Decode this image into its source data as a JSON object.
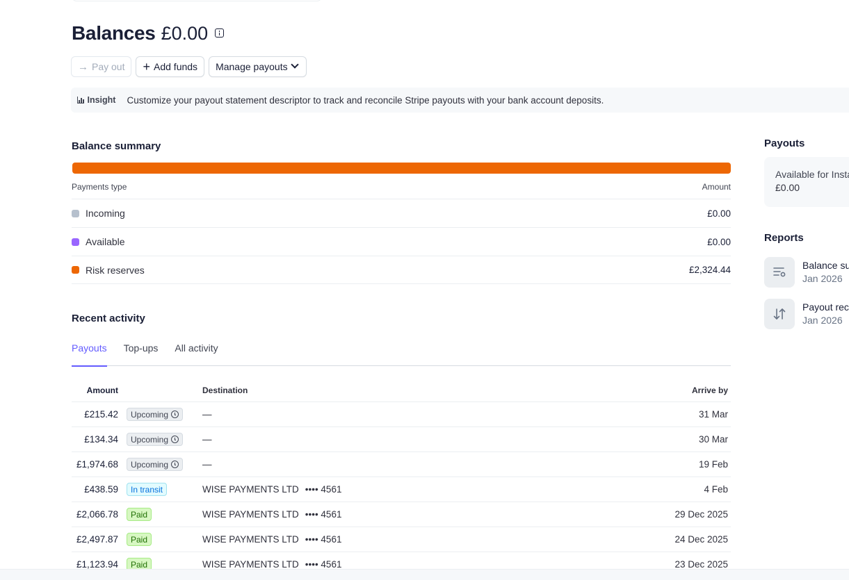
{
  "header": {
    "title": "Balances",
    "amount": "£0.00"
  },
  "actions": {
    "pay_out": "Pay out",
    "add_funds": "Add funds",
    "manage_payouts": "Manage payouts"
  },
  "insight": {
    "badge": "Insight",
    "text": "Customize your payout statement descriptor to track and reconcile Stripe payouts with your bank account deposits."
  },
  "balance_summary": {
    "title": "Balance summary",
    "bar_color": "#ed6704",
    "col_type": "Payments type",
    "col_amount": "Amount",
    "rows": [
      {
        "label": "Incoming",
        "amount": "£0.00",
        "color": "#b6c0cd"
      },
      {
        "label": "Available",
        "amount": "£0.00",
        "color": "#9966ff"
      },
      {
        "label": "Risk reserves",
        "amount": "£2,324.44",
        "color": "#ed6704"
      }
    ]
  },
  "recent_activity": {
    "title": "Recent activity",
    "tabs": [
      {
        "label": "Payouts",
        "active": true
      },
      {
        "label": "Top-ups",
        "active": false
      },
      {
        "label": "All activity",
        "active": false
      }
    ],
    "columns": {
      "amount": "Amount",
      "destination": "Destination",
      "arrive_by": "Arrive by"
    },
    "rows": [
      {
        "amount": "£215.42",
        "status": "Upcoming",
        "destination": "—",
        "masked": "",
        "arrive_by": "31 Mar"
      },
      {
        "amount": "£134.34",
        "status": "Upcoming",
        "destination": "—",
        "masked": "",
        "arrive_by": "30 Mar"
      },
      {
        "amount": "£1,974.68",
        "status": "Upcoming",
        "destination": "—",
        "masked": "",
        "arrive_by": "19 Feb"
      },
      {
        "amount": "£438.59",
        "status": "In transit",
        "destination": "WISE PAYMENTS LTD",
        "masked": "•••• 4561",
        "arrive_by": "4 Feb"
      },
      {
        "amount": "£2,066.78",
        "status": "Paid",
        "destination": "WISE PAYMENTS LTD",
        "masked": "•••• 4561",
        "arrive_by": "29 Dec 2025"
      },
      {
        "amount": "£2,497.87",
        "status": "Paid",
        "destination": "WISE PAYMENTS LTD",
        "masked": "•••• 4561",
        "arrive_by": "24 Dec 2025"
      },
      {
        "amount": "£1,123.94",
        "status": "Paid",
        "destination": "WISE PAYMENTS LTD",
        "masked": "•••• 4561",
        "arrive_by": "23 Dec 2025"
      }
    ]
  },
  "side": {
    "payouts_title": "Payouts",
    "payout_card_label": "Available for Insta",
    "payout_card_amount": "£0.00",
    "reports_title": "Reports",
    "reports": [
      {
        "name": "Balance su",
        "date": "Jan 2026",
        "icon": "list-filter-icon"
      },
      {
        "name": "Payout rec",
        "date": "Jan 2026",
        "icon": "arrows-up-down-icon"
      }
    ]
  }
}
